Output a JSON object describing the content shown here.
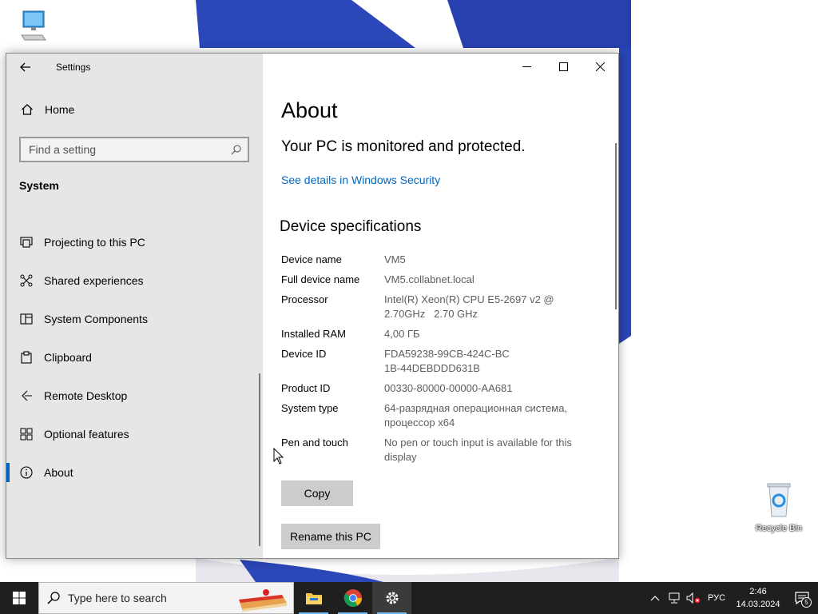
{
  "desktop": {
    "recycle_bin_label": "Recycle Bin"
  },
  "window": {
    "app_title": "Settings",
    "home_label": "Home",
    "search_placeholder": "Find a setting",
    "section_title": "System",
    "nav_items": [
      {
        "label": "Projecting to this PC",
        "icon": "projector-icon"
      },
      {
        "label": "Shared experiences",
        "icon": "shared-icon"
      },
      {
        "label": "System Components",
        "icon": "components-icon"
      },
      {
        "label": "Clipboard",
        "icon": "clipboard-icon"
      },
      {
        "label": "Remote Desktop",
        "icon": "remote-desktop-icon"
      },
      {
        "label": "Optional features",
        "icon": "optional-features-icon"
      },
      {
        "label": "About",
        "icon": "info-icon",
        "active": true
      }
    ]
  },
  "about": {
    "title": "About",
    "protection_status": "Your PC is monitored and protected.",
    "security_link": "See details in Windows Security",
    "specs_heading": "Device specifications",
    "specs": [
      {
        "key": "Device name",
        "value": "VM5"
      },
      {
        "key": "Full device name",
        "value": "VM5.collabnet.local"
      },
      {
        "key": "Processor",
        "value": "Intel(R) Xeon(R) CPU E5-2697 v2 @ 2.70GHz   2.70 GHz"
      },
      {
        "key": "Installed RAM",
        "value": "4,00 ГБ"
      },
      {
        "key": "Device ID",
        "value": "FDA59238-99CB-424C-BC1B-44DEBDDD631B"
      },
      {
        "key": "Product ID",
        "value": "00330-80000-00000-AA681"
      },
      {
        "key": "System type",
        "value": "64-разрядная операционная система, процессор x64"
      },
      {
        "key": "Pen and touch",
        "value": "No pen or touch input is available for this display"
      }
    ],
    "copy_button": "Copy",
    "rename_button": "Rename this PC"
  },
  "taskbar": {
    "search_placeholder": "Type here to search",
    "language": "РУС",
    "time": "2:46",
    "date": "14.03.2024",
    "notification_count": "5"
  },
  "colors": {
    "accent": "#0067c0",
    "sidebar_bg": "#e6e6e6",
    "taskbar_bg": "#1f1f1f",
    "wallpaper_blue": "#2b47b8"
  }
}
